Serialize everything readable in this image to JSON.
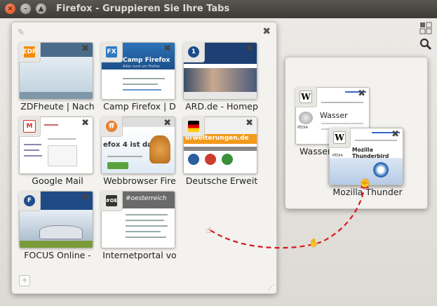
{
  "window": {
    "title": "Firefox - Gruppieren Sie Ihre Tabs"
  },
  "toolbar": {
    "groups_icon": "tab-groups-icon",
    "search_icon": "search-icon"
  },
  "group1": {
    "tabs": [
      {
        "label": "ZDFheute | Nach",
        "favicon": "ZDF"
      },
      {
        "label": "Camp Firefox | D",
        "favicon": "FX"
      },
      {
        "label": "ARD.de - Homep",
        "favicon": "1"
      },
      {
        "label": "Google Mail",
        "favicon": "M"
      },
      {
        "label": "Webbrowser Fire",
        "favicon": "ff"
      },
      {
        "label": "Deutsche Erweit",
        "favicon": "de"
      },
      {
        "label": "FOCUS Online -",
        "favicon": "F"
      },
      {
        "label": "Internetportal vo",
        "favicon": "#OE"
      }
    ],
    "thumb_texts": {
      "camp_heading": "Camp Firefox",
      "camp_sub": "Alles rund um Firefox",
      "web_text": "efox 4 ist da!",
      "ext_text": "erweiterungen.de",
      "oe_text": "#oesterreich"
    }
  },
  "group2": {
    "tabs": [
      {
        "label": "Wasser",
        "title_in_thumb": "Wasser",
        "favicon": "W"
      },
      {
        "label": "Mozilla Thunder",
        "title_in_thumb": "Mozilla Thunderbird",
        "favicon": "W"
      }
    ],
    "wiki_label": "PEDIA"
  }
}
